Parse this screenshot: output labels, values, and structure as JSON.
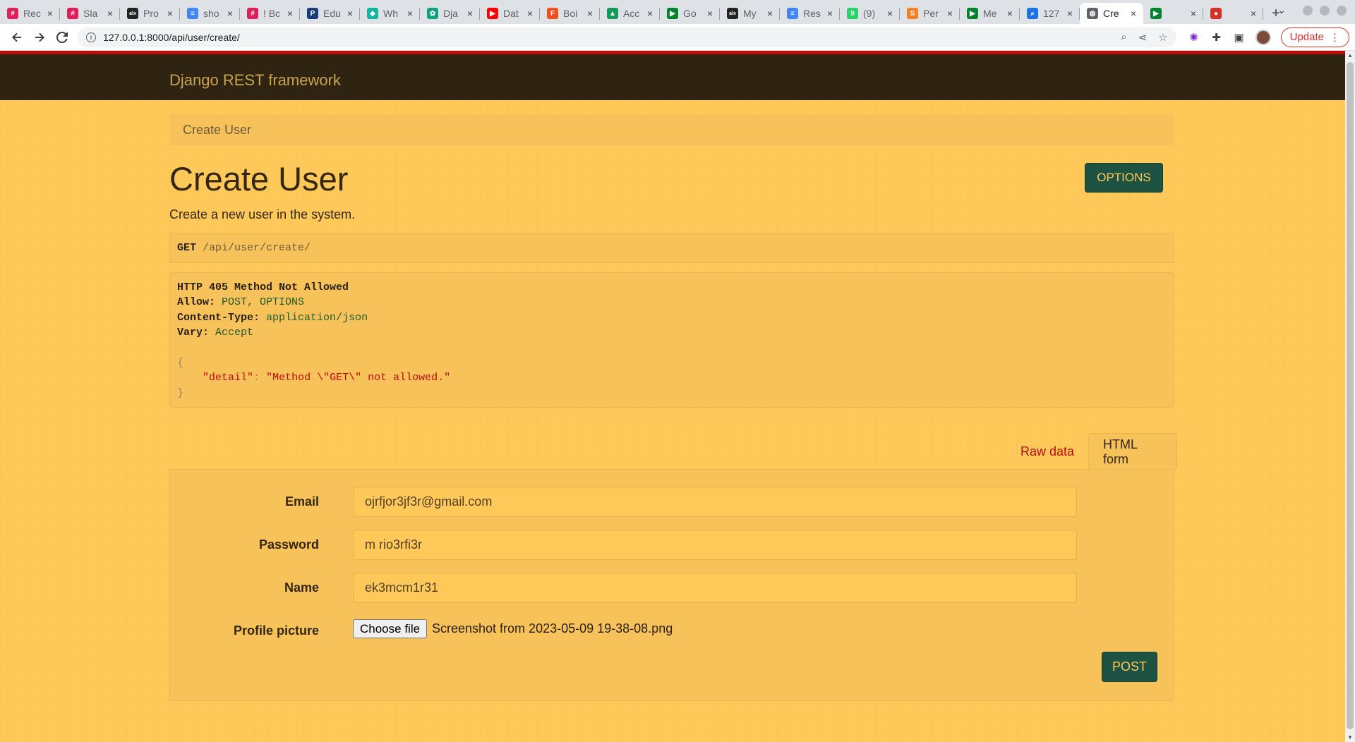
{
  "browser": {
    "tabs": [
      {
        "title": "Rec",
        "icon": "slack-icon",
        "color": "#e01e5a"
      },
      {
        "title": "Sla",
        "icon": "slack-icon",
        "color": "#e01e5a"
      },
      {
        "title": "Pro",
        "icon": "alx-icon",
        "color": "#222222"
      },
      {
        "title": "sho",
        "icon": "docs-icon",
        "color": "#4285f4"
      },
      {
        "title": "! Bc",
        "icon": "slack-icon",
        "color": "#e01e5a"
      },
      {
        "title": "Edu",
        "icon": "edu-icon",
        "color": "#1a3c7a"
      },
      {
        "title": "Wh",
        "icon": "wh-icon",
        "color": "#0fb6a3"
      },
      {
        "title": "Dja",
        "icon": "chatgpt-icon",
        "color": "#10a37f"
      },
      {
        "title": "Dat",
        "icon": "youtube-icon",
        "color": "#ff0000"
      },
      {
        "title": "Boi",
        "icon": "figma-icon",
        "color": "#f24e1e"
      },
      {
        "title": "Acc",
        "icon": "drive-icon",
        "color": "#0f9d58"
      },
      {
        "title": "Go",
        "icon": "meet-icon",
        "color": "#00832d"
      },
      {
        "title": "My",
        "icon": "alx-icon",
        "color": "#222222"
      },
      {
        "title": "Res",
        "icon": "docs-icon",
        "color": "#4285f4"
      },
      {
        "title": "(9)",
        "icon": "whatsapp-icon",
        "color": "#25d366"
      },
      {
        "title": "Per",
        "icon": "stack-icon",
        "color": "#f48024"
      },
      {
        "title": "Me",
        "icon": "meet-icon",
        "color": "#00832d"
      },
      {
        "title": "127",
        "icon": "search-icon",
        "color": "#1a73e8"
      },
      {
        "title": "Cre",
        "icon": "globe-icon",
        "color": "#5f6368",
        "active": true
      },
      {
        "title": "",
        "icon": "meet-icon",
        "color": "#00832d"
      },
      {
        "title": "",
        "icon": "record-icon",
        "color": "#d93025"
      }
    ],
    "url": "127.0.0.1:8000/api/user/create/",
    "update_label": "Update"
  },
  "drf": {
    "brand": "Django REST framework",
    "breadcrumb": "Create User",
    "title": "Create User",
    "options_label": "OPTIONS",
    "description": "Create a new user in the system.",
    "request": {
      "method": "GET",
      "path": "/api/user/create/"
    },
    "response": {
      "status_line": "HTTP 405 Method Not Allowed",
      "headers": [
        {
          "name": "Allow:",
          "value": "POST, OPTIONS"
        },
        {
          "name": "Content-Type:",
          "value": "application/json"
        },
        {
          "name": "Vary:",
          "value": "Accept"
        }
      ],
      "open_brace": "{",
      "json_key": "\"detail\"",
      "colon": ":",
      "json_value": "\"Method \\\"GET\\\" not allowed.\"",
      "close_brace": "}"
    },
    "form_tabs": {
      "raw": "Raw data",
      "html": "HTML form"
    },
    "form": {
      "email_label": "Email",
      "email_value": "ojrfjor3jf3r@gmail.com",
      "password_label": "Password",
      "password_value": "m rio3rfi3r",
      "name_label": "Name",
      "name_value": "ek3mcm1r31",
      "picture_label": "Profile picture",
      "choose_file_label": "Choose file",
      "file_name": "Screenshot from 2023-05-09 19-38-08.png",
      "post_label": "POST"
    }
  },
  "colors": {
    "page_bg": "#ffc95a",
    "navbar_bg": "#2f2411",
    "navbar_border": "#b90e0a",
    "button_bg": "#1e5242",
    "link_red": "#b90e0a"
  }
}
